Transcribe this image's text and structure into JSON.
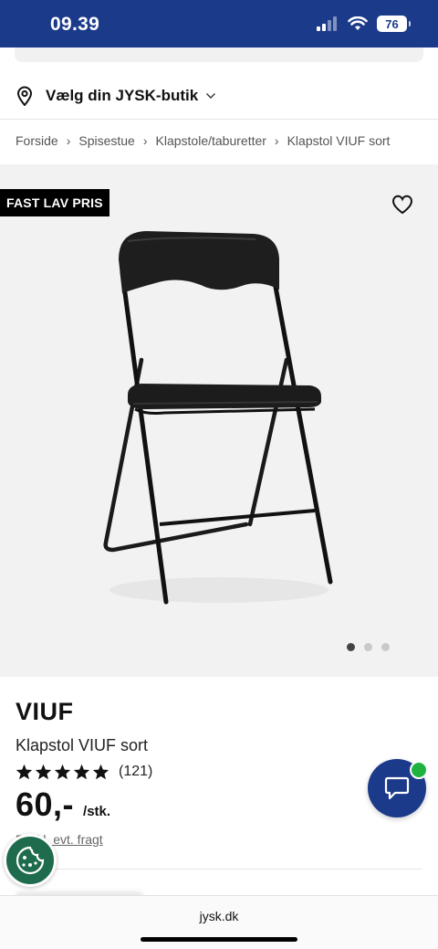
{
  "status_bar": {
    "time": "09.39",
    "battery": "76",
    "background": "#1b3a8a"
  },
  "store": {
    "label": "Vælg din JYSK-butik",
    "icon": "location-pin-icon"
  },
  "breadcrumb": [
    {
      "label": "Forside"
    },
    {
      "label": "Spisestue"
    },
    {
      "label": "Klapstole/taburetter"
    },
    {
      "label": "Klapstol VIUF sort"
    }
  ],
  "gallery": {
    "badge": "FAST LAV PRIS",
    "image_count": 3,
    "active_image": 1
  },
  "product": {
    "brand": "VIUF",
    "name": "Klapstol VIUF sort",
    "rating": 5,
    "rating_count": "(121)",
    "price": "60,-",
    "unit": "/stk.",
    "shipping_text": "Ekskl. evt. fragt"
  },
  "browser": {
    "url": "jysk.dk"
  },
  "colors": {
    "brand_blue": "#1b3a8a",
    "online_green": "#1fb23f",
    "cookie_green": "#1f6b4d"
  }
}
